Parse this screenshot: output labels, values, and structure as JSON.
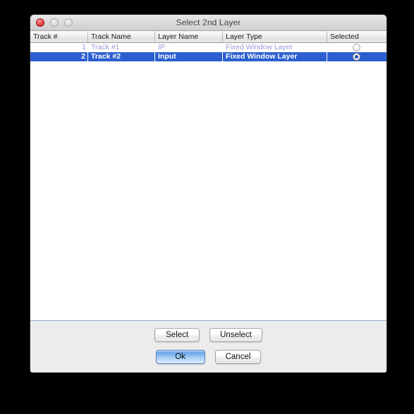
{
  "window": {
    "title": "Select 2nd Layer",
    "controls": {
      "close": "close-button",
      "minimize": "minimize-button",
      "zoom": "zoom-button"
    }
  },
  "table": {
    "columns": [
      {
        "key": "track_number",
        "label": "Track #"
      },
      {
        "key": "track_name",
        "label": "Track Name"
      },
      {
        "key": "layer_name",
        "label": "Layer Name"
      },
      {
        "key": "layer_type",
        "label": "Layer Type"
      },
      {
        "key": "selected",
        "label": "Selected"
      }
    ],
    "rows": [
      {
        "track_number": "1",
        "track_name": "Track #1",
        "layer_name": "IP",
        "layer_type": "Fixed Window Layer",
        "selected": false,
        "state": "disabled"
      },
      {
        "track_number": "2",
        "track_name": "Track #2",
        "layer_name": "Input",
        "layer_type": "Fixed Window Layer",
        "selected": true,
        "state": "selected"
      }
    ]
  },
  "buttons": {
    "select": "Select",
    "unselect": "Unselect",
    "ok": "Ok",
    "cancel": "Cancel"
  },
  "colors": {
    "selection_blue": "#2b5fd0",
    "disabled_text": "#9a9ad8",
    "default_button_blue": "#6ea6ea",
    "window_chrome": "#ececec"
  }
}
